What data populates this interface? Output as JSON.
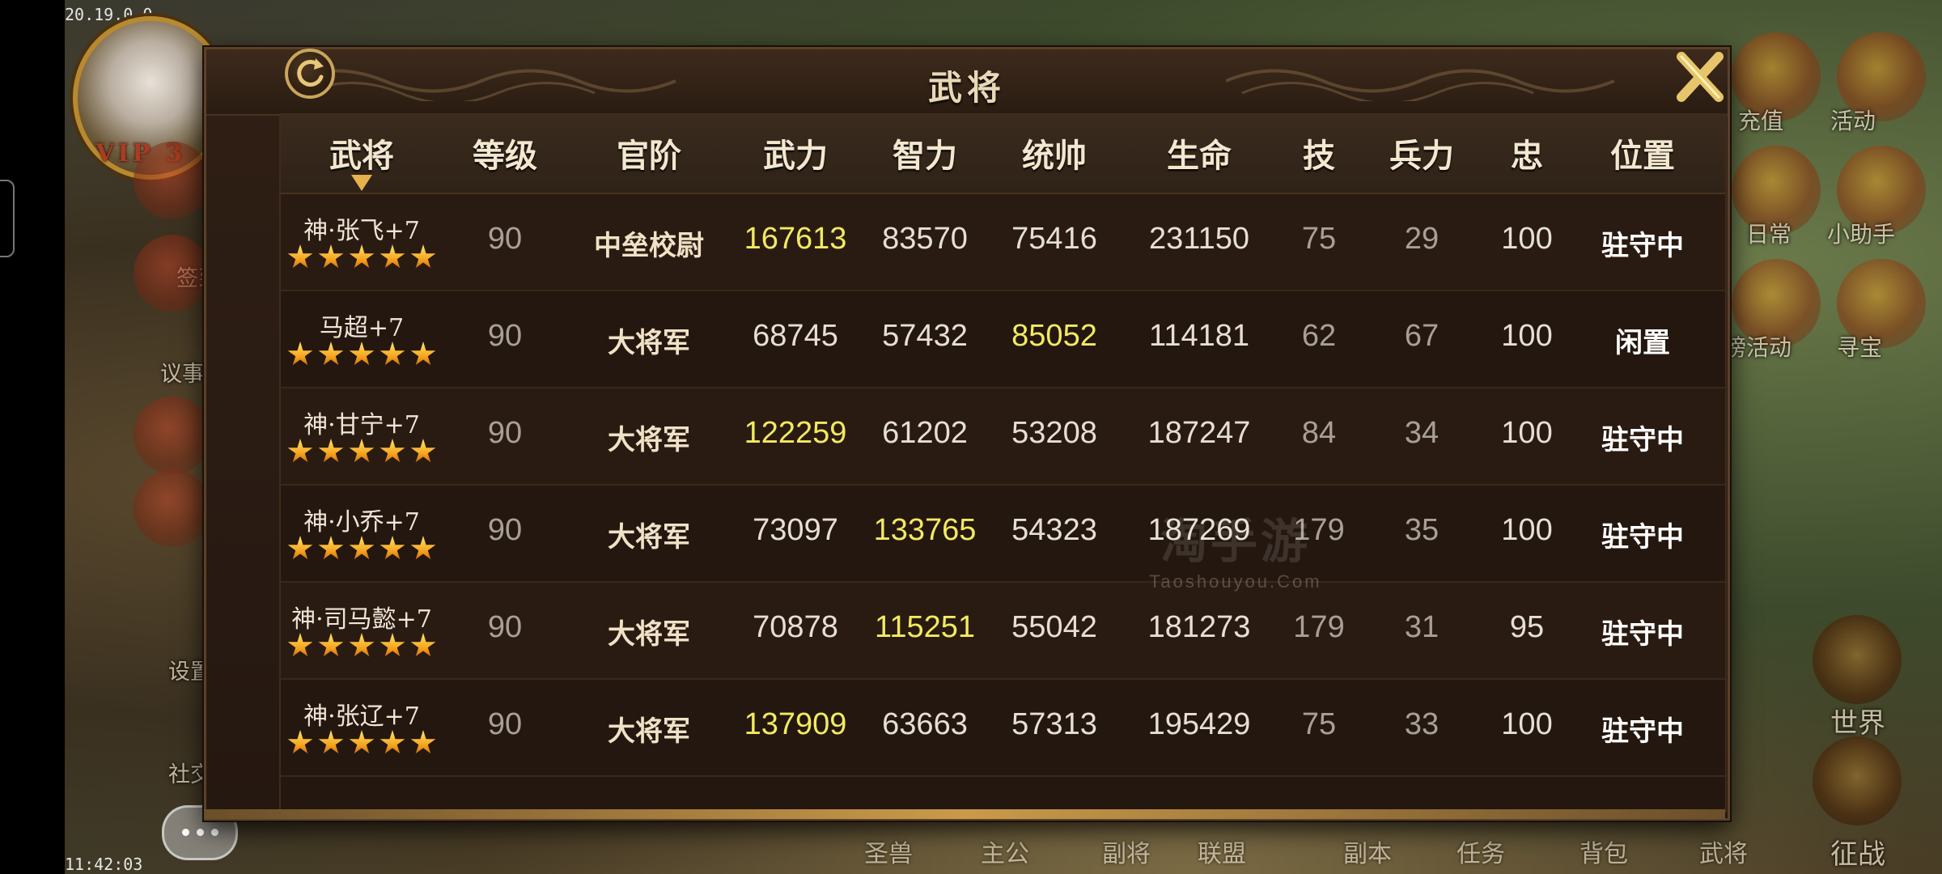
{
  "status": {
    "top_left": "20.19.0.0",
    "bottom_left": "11:42:03"
  },
  "player": {
    "vip": "VIP 3"
  },
  "side_left": [
    {
      "label": "签到",
      "icon": "sign-in-icon"
    },
    {
      "label": "议事厅",
      "icon": "council-hall-icon"
    },
    {
      "label": "设置",
      "icon": "gear-icon"
    },
    {
      "label": "社交",
      "icon": "social-icon"
    }
  ],
  "side_right": [
    {
      "label": "充值",
      "icon": "recharge-icon"
    },
    {
      "label": "活动",
      "icon": "gift-icon"
    },
    {
      "label": "日常",
      "icon": "daily-icon"
    },
    {
      "label": "小助手",
      "icon": "helper-scroll-icon"
    },
    {
      "label": "榜活动",
      "icon": "ranking-event-icon"
    },
    {
      "label": "寻宝",
      "icon": "treasure-chest-icon"
    },
    {
      "label": "世界",
      "icon": "dragon-world-icon"
    },
    {
      "label": "征战",
      "icon": "dragon-battle-icon"
    }
  ],
  "bottom_nav": [
    "圣兽",
    "主公",
    "副将",
    "联盟",
    "副本",
    "任务",
    "背包",
    "武将"
  ],
  "dialog": {
    "title": "武将",
    "watermark_big": "淘手游",
    "watermark_small": "Taoshouyou.Com",
    "columns": [
      "武将",
      "等级",
      "官阶",
      "武力",
      "智力",
      "统帅",
      "生命",
      "技",
      "兵力",
      "忠",
      "位置"
    ],
    "rows": [
      {
        "name": "神·张飞+7",
        "stars": 5,
        "level": "90",
        "rank": "中垒校尉",
        "might": "167613",
        "intellect": "83570",
        "command": "75416",
        "hp": "231150",
        "skill": "75",
        "troops": "29",
        "loyalty": "100",
        "position": "驻守中",
        "highlight": "might"
      },
      {
        "name": "马超+7",
        "stars": 5,
        "level": "90",
        "rank": "大将军",
        "might": "68745",
        "intellect": "57432",
        "command": "85052",
        "hp": "114181",
        "skill": "62",
        "troops": "67",
        "loyalty": "100",
        "position": "闲置",
        "highlight": "command"
      },
      {
        "name": "神·甘宁+7",
        "stars": 5,
        "level": "90",
        "rank": "大将军",
        "might": "122259",
        "intellect": "61202",
        "command": "53208",
        "hp": "187247",
        "skill": "84",
        "troops": "34",
        "loyalty": "100",
        "position": "驻守中",
        "highlight": "might"
      },
      {
        "name": "神·小乔+7",
        "stars": 5,
        "level": "90",
        "rank": "大将军",
        "might": "73097",
        "intellect": "133765",
        "command": "54323",
        "hp": "187269",
        "skill": "179",
        "troops": "35",
        "loyalty": "100",
        "position": "驻守中",
        "highlight": "intellect"
      },
      {
        "name": "神·司马懿+7",
        "stars": 5,
        "level": "90",
        "rank": "大将军",
        "might": "70878",
        "intellect": "115251",
        "command": "55042",
        "hp": "181273",
        "skill": "179",
        "troops": "31",
        "loyalty": "95",
        "position": "驻守中",
        "highlight": "intellect"
      },
      {
        "name": "神·张辽+7",
        "stars": 5,
        "level": "90",
        "rank": "大将军",
        "might": "137909",
        "intellect": "63663",
        "command": "57313",
        "hp": "195429",
        "skill": "75",
        "troops": "33",
        "loyalty": "100",
        "position": "驻守中",
        "highlight": "might"
      }
    ]
  },
  "colors": {
    "highlight": "#f2ea62",
    "star": "#f5a21c",
    "panel": "#24170f"
  }
}
